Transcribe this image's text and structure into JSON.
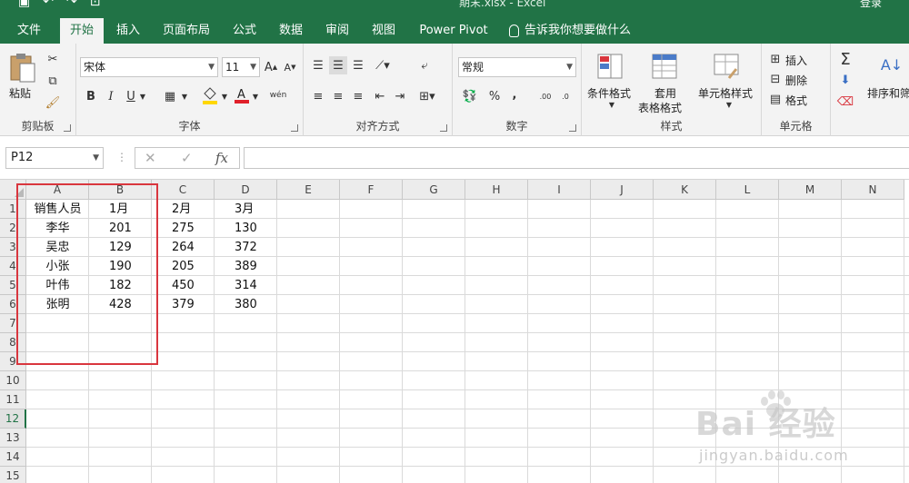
{
  "titlebar": {
    "title": "期末.xlsx - Excel",
    "signin": "登录",
    "bg_color": "#217346"
  },
  "tabs": [
    {
      "label": "文件",
      "active": false
    },
    {
      "label": "开始",
      "active": true
    },
    {
      "label": "插入",
      "active": false
    },
    {
      "label": "页面布局",
      "active": false
    },
    {
      "label": "公式",
      "active": false
    },
    {
      "label": "数据",
      "active": false
    },
    {
      "label": "审阅",
      "active": false
    },
    {
      "label": "视图",
      "active": false
    },
    {
      "label": "Power Pivot",
      "active": false
    }
  ],
  "tellme": "告诉我你想要做什么",
  "ribbon": {
    "clipboard": {
      "paste_label": "粘贴",
      "group_label": "剪贴板"
    },
    "font": {
      "font_name": "宋体",
      "font_size": "11",
      "bold": "B",
      "italic": "I",
      "underline": "U",
      "group_label": "字体",
      "font_color": "#e0202a",
      "highlight_color": "#ffd700"
    },
    "alignment": {
      "group_label": "对齐方式"
    },
    "number": {
      "format": "常规",
      "percent": "%",
      "comma": ",",
      "group_label": "数字"
    },
    "styles": {
      "conditional": "条件格式",
      "table_fmt_1": "套用",
      "table_fmt_2": "表格格式",
      "cell_styles": "单元格样式",
      "group_label": "样式"
    },
    "cells": {
      "insert": "插入",
      "delete": "删除",
      "format": "格式",
      "group_label": "单元格"
    },
    "editing": {
      "sort_filter": "排序和筛"
    }
  },
  "formula_bar": {
    "name_box": "P12",
    "fx": "fx",
    "formula": ""
  },
  "columns": [
    "A",
    "B",
    "C",
    "D",
    "E",
    "F",
    "G",
    "H",
    "I",
    "J",
    "K",
    "L",
    "M",
    "N"
  ],
  "rows": [
    "1",
    "2",
    "3",
    "4",
    "5",
    "6",
    "7",
    "8",
    "9",
    "10",
    "11",
    "12",
    "13",
    "14",
    "15"
  ],
  "selected_row": "12",
  "table": {
    "headers": [
      "销售人员",
      "1月",
      "2月",
      "3月"
    ],
    "data": [
      [
        "李华",
        "201",
        "275",
        "130"
      ],
      [
        "吴忠",
        "129",
        "264",
        "372"
      ],
      [
        "小张",
        "190",
        "205",
        "389"
      ],
      [
        "叶伟",
        "182",
        "450",
        "314"
      ],
      [
        "张明",
        "428",
        "379",
        "380"
      ]
    ]
  },
  "highlight_box_color": "#d9363e",
  "watermark": {
    "main": "Bai 经验",
    "sub": "jingyan.baidu.com"
  }
}
